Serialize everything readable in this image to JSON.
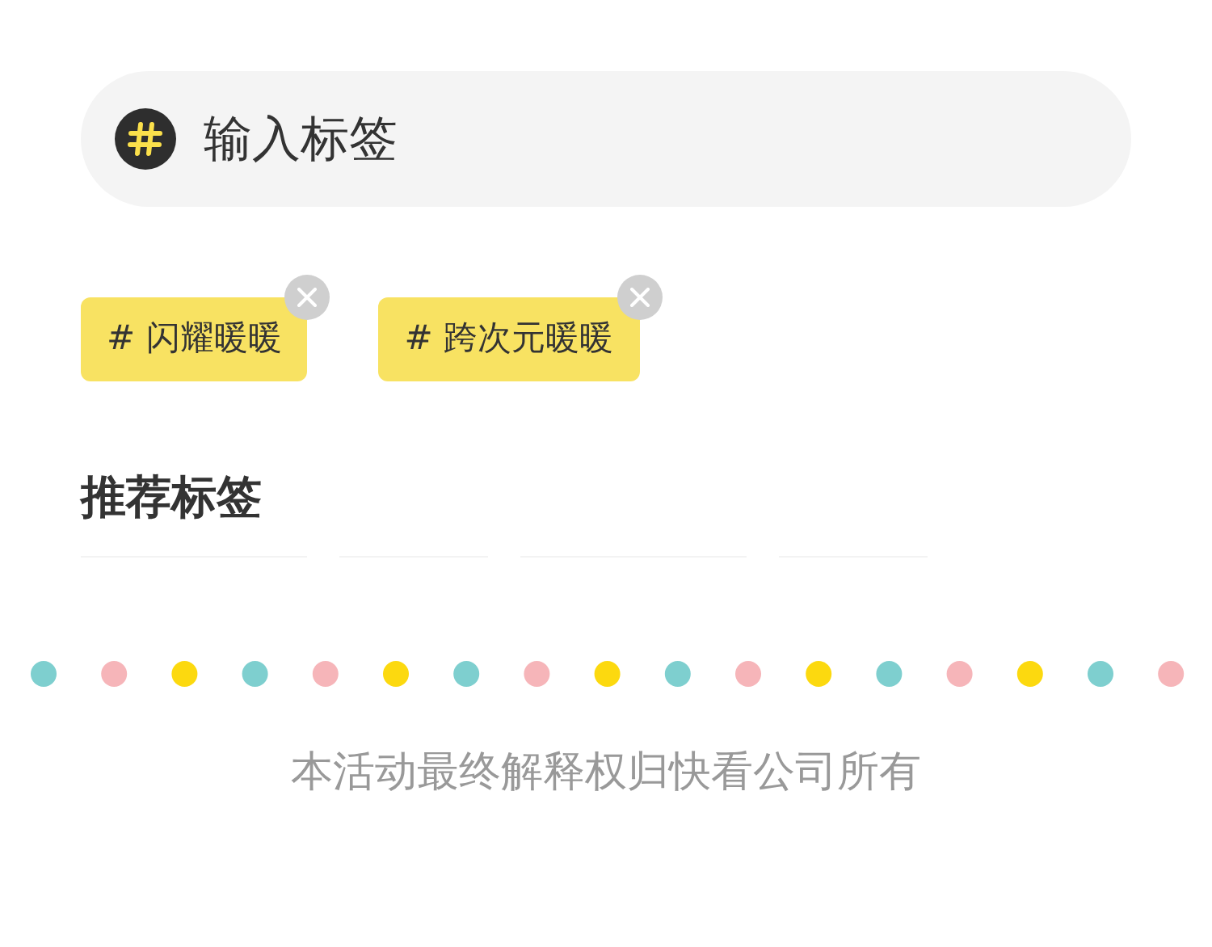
{
  "search": {
    "placeholder": "输入标签"
  },
  "selected_tags": [
    {
      "label": "# 闪耀暖暖"
    },
    {
      "label": "# 跨次元暖暖"
    }
  ],
  "recommended": {
    "title": "推荐标签"
  },
  "footer": "本活动最终解释权归快看公司所有"
}
